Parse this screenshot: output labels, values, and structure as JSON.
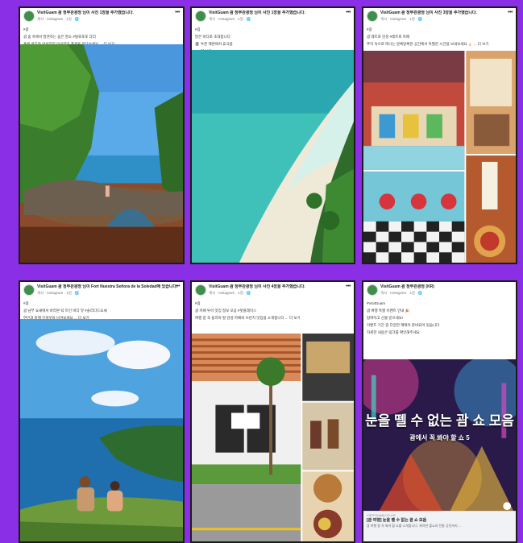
{
  "posts": [
    {
      "page_name": "VisitGuam 괌 정부관광청 님이 사진 1장을 추가했습니다.",
      "sub": "게시 · Instagram · 1일 · 🌐",
      "lines": [
        "#괌",
        "괌 숲 속에서 발견하는 숨은 명소 #탈로포포 다리",
        "푸른 바다와 어우러진 이국적인 풍경을 만나보세요 ... 더 보기"
      ]
    },
    {
      "page_name": "VisitGuam 괌 정부관광청 님이 사진 1장을 추가했습니다.",
      "sub": "게시 · Instagram · 1일 · 🌐",
      "lines": [
        "#괌",
        "맑은 바다로 초대합니다",
        "🏖 투몬 해변에서 휴식을",
        "👀 더 보기"
      ]
    },
    {
      "page_name": "VisitGuam 괌 정부관광청 님이 사진 3장을 추가했습니다.",
      "sub": "게시 · Instagram · 1일 · 🌐",
      "lines": [
        "#괌",
        "괌 레트로 감성 #레트로 카페",
        "추억 속으로 떠나는 알록달록한 공간에서 특별한 시간을 보내보세요 🍦 ... 더 보기"
      ]
    },
    {
      "page_name": "VisitGuam 괌 정부관광청 님이 Fort Nuestra Señora de la Soledad에 있습니다.",
      "sub": "게시 · Instagram · 1일 · 🌐",
      "lines": [
        "#괌",
        "괌 남부 요새에서 바라본 탁 트인 바다 뷰 #솔리다드요새",
        "연인과 함께 인생샷을 남겨보세요 ... 더 보기"
      ]
    },
    {
      "page_name": "VisitGuam 괌 정부관광청 님이 사진 4장을 추가했습니다.",
      "sub": "게시 · Instagram · 1일 · 🌐",
      "lines": [
        "#괌",
        "괌 카페 투어 맛집 정보 모음 #핫플레이스",
        "여행 중 꼭 들러야 할 감성 카페와 브런치 맛집을 소개합니다 ... 더 보기"
      ]
    },
    {
      "page_name": "VisitGuam 괌 정부관광청 (KR)",
      "sub": "게시 · Instagram · 1일 · 🌐",
      "lines": [
        "#VisitGuam",
        "괌 여행 특별 이벤트 안내 🎉",
        "참여하고 선물 받으세요!",
        "이벤트 기간 중 다양한 혜택이 준비되어 있습니다",
        "자세한 내용은 링크를 확인해주세요"
      ],
      "overlay_title": "눈을 뗄 수 없는 괌 쇼 모음",
      "overlay_sub": "괌에서 꼭 봐야 할 쇼 5",
      "link_domain": "VISITGUAM.CO.KR",
      "link_title": "[괌 여행] 눈을 뗄 수 없는 괌 쇼 모음",
      "link_desc": "괌 여행 중 꼭 봐야 할 쇼를 소개합니다. 화려한 불쇼와 전통 공연까지 ..."
    }
  ],
  "colors": {
    "background": "#8a2fe6",
    "card_border": "#1c1c1c"
  }
}
